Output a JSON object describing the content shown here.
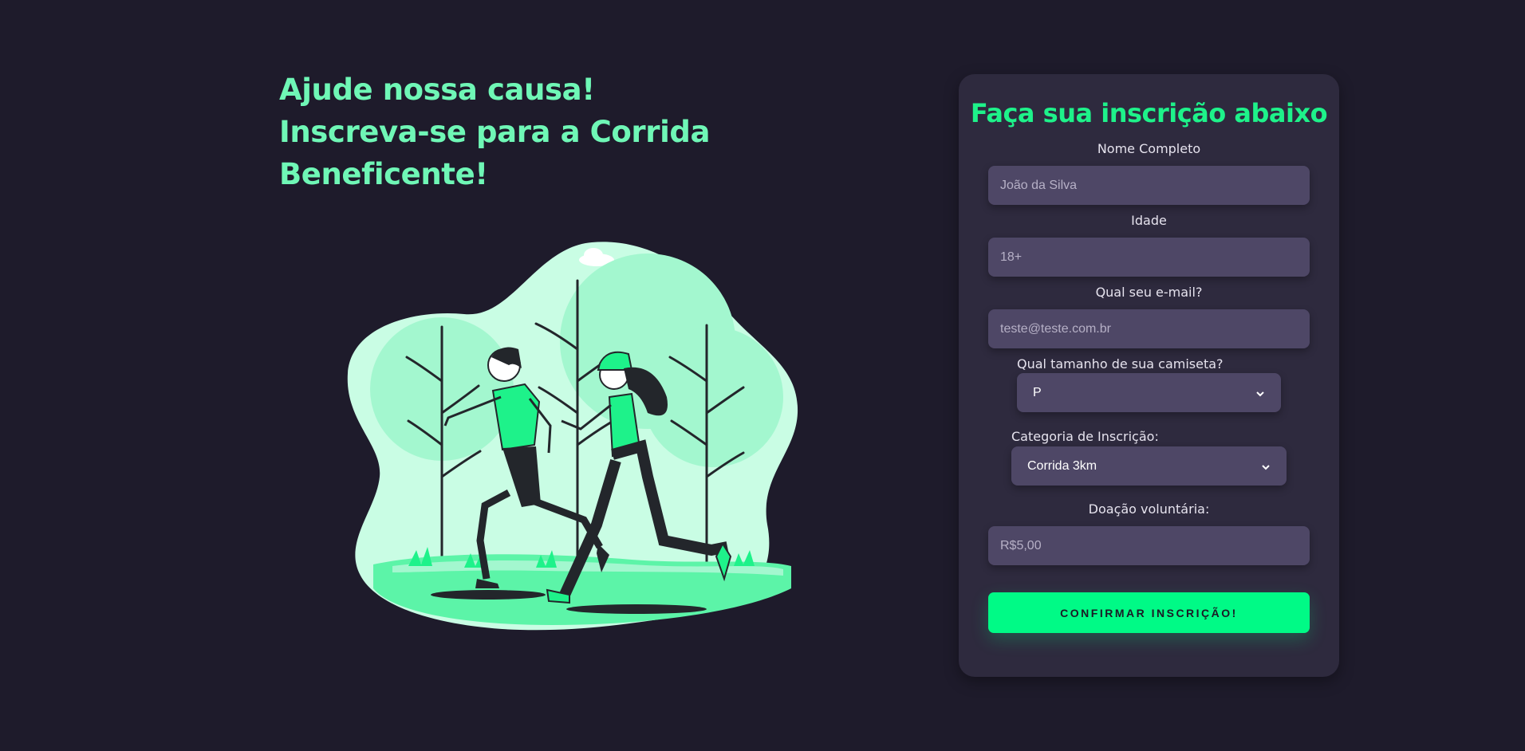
{
  "hero": {
    "line1": "Ajude nossa causa!",
    "line2": "Inscreva-se para a Corrida Beneficente!"
  },
  "illustration": {
    "icon": "runners-illustration",
    "colors": {
      "blob": "#c9fde4",
      "tree": "#a3f7cf",
      "grass": "#5cf4a8",
      "accent": "#1ef28a",
      "ink": "#23262b"
    }
  },
  "form": {
    "title": "Faça sua inscrição abaixo",
    "name": {
      "label": "Nome Completo",
      "placeholder": "João da Silva"
    },
    "age": {
      "label": "Idade",
      "placeholder": "18+"
    },
    "email": {
      "label": "Qual seu e-mail?",
      "placeholder": "teste@teste.com.br"
    },
    "shirt": {
      "label": "Qual tamanho de sua camiseta?",
      "selected": "P",
      "icon": "chevron-down-icon"
    },
    "category": {
      "label": "Categoria de Inscrição:",
      "selected": "Corrida 3km",
      "icon": "chevron-down-icon"
    },
    "donation": {
      "label": "Doação voluntária:",
      "placeholder": "R$5,00"
    },
    "submit_label": "CONFIRMAR INSCRIÇÃO!"
  },
  "colors": {
    "background": "#1e1b2b",
    "card": "#2e2a3e",
    "field": "#4e4766",
    "heading": "#6ff7b6",
    "accent": "#00fa86"
  }
}
